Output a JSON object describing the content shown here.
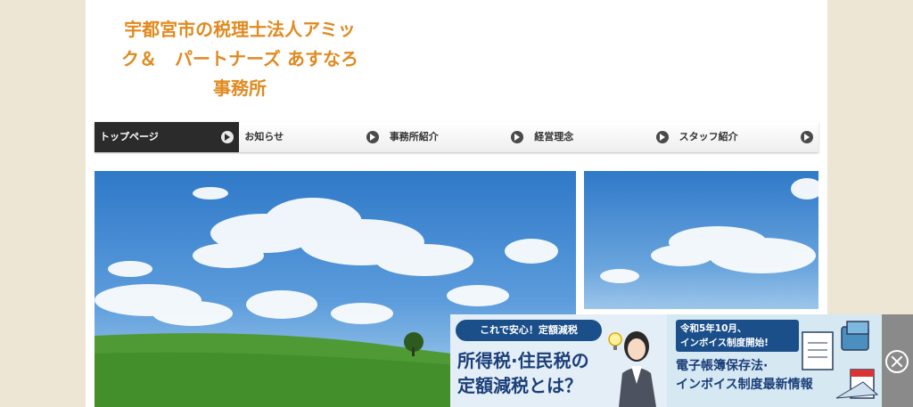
{
  "site": {
    "title_line1": "宇都宮市の税理士法人アミッ",
    "title_line2": "ク＆　パートナーズ あすなろ",
    "title_line3": "事務所"
  },
  "nav": {
    "items": [
      {
        "label": "トップページ",
        "active": true
      },
      {
        "label": "お知らせ"
      },
      {
        "label": "事務所紹介"
      },
      {
        "label": "経営理念"
      },
      {
        "label": "スタッフ紹介"
      }
    ]
  },
  "banner": {
    "left_tag": "これで安心！定額減税",
    "left_heading_line1": "所得税·住民税の",
    "left_heading_line2": "定額減税とは？",
    "right_badge_line1": "令和5年10月、",
    "right_badge_line2": "インボイス制度開始!",
    "right_heading_line1": "電子帳簿保存法·",
    "right_heading_line2": "インボイス制度最新情報",
    "close_icon": "close-circle-icon"
  },
  "colors": {
    "background": "#ede6d4",
    "title": "#e08a1f",
    "nav_active": "#2b2b2b",
    "banner_navy": "#1b4f8a"
  }
}
